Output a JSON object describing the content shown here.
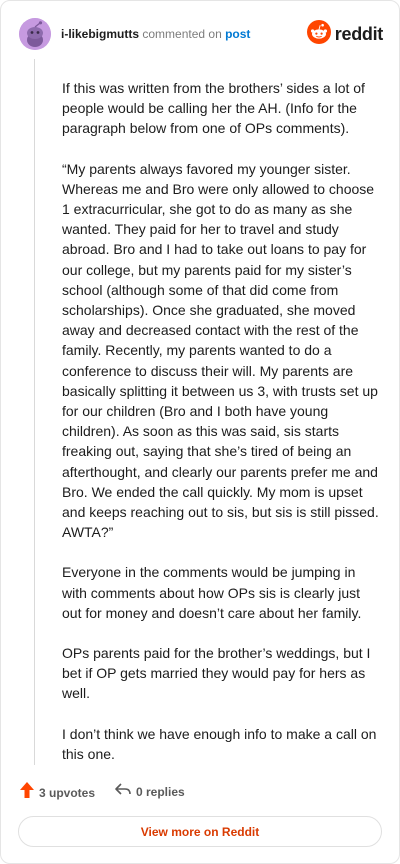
{
  "header": {
    "username": "i-likebigmutts",
    "action": "commented on",
    "link_text": "post",
    "brand": "reddit"
  },
  "comment": {
    "paragraphs": [
      "If this was written from the brothers’ sides a lot of people would be calling her the AH. (Info for the paragraph below from one of OPs comments).",
      "“My parents always favored my younger sister. Whereas me and Bro were only allowed to choose 1 extracurricular, she got to do as many as she wanted. They paid for her to travel and study abroad. Bro and I had to take out loans to pay for our college, but my parents paid for my sister’s school (although some of that did come from scholarships). Once she graduated, she moved away and decreased contact with the rest of the family. Recently, my parents wanted to do a conference to discuss their will. My parents are basically splitting it between us 3, with trusts set up for our children (Bro and I both have young children). As soon as this was said, sis starts freaking out, saying that she’s tired of being an afterthought, and clearly our parents prefer me and Bro. We ended the call quickly. My mom is upset and keeps reaching out to sis, but sis is still pissed. AWTA?”",
      "Everyone in the comments would be jumping in with comments about how OPs sis is clearly just out for money and doesn’t care about her family.",
      "OPs parents paid for the brother’s weddings, but I bet if OP gets married they would pay for hers as well.",
      "I don’t think we have enough info to make a call on this one."
    ]
  },
  "footer": {
    "upvotes": "3 upvotes",
    "replies": "0 replies"
  },
  "view_more": "View more on Reddit",
  "colors": {
    "accent": "#d93a00",
    "link": "#0079d3",
    "reddit_orange": "#ff4500",
    "avatar": "#c69ae0"
  },
  "icons": [
    "snoo-avatar-icon",
    "reddit-logo-icon",
    "upvote-arrow-icon",
    "reply-arrow-icon"
  ]
}
